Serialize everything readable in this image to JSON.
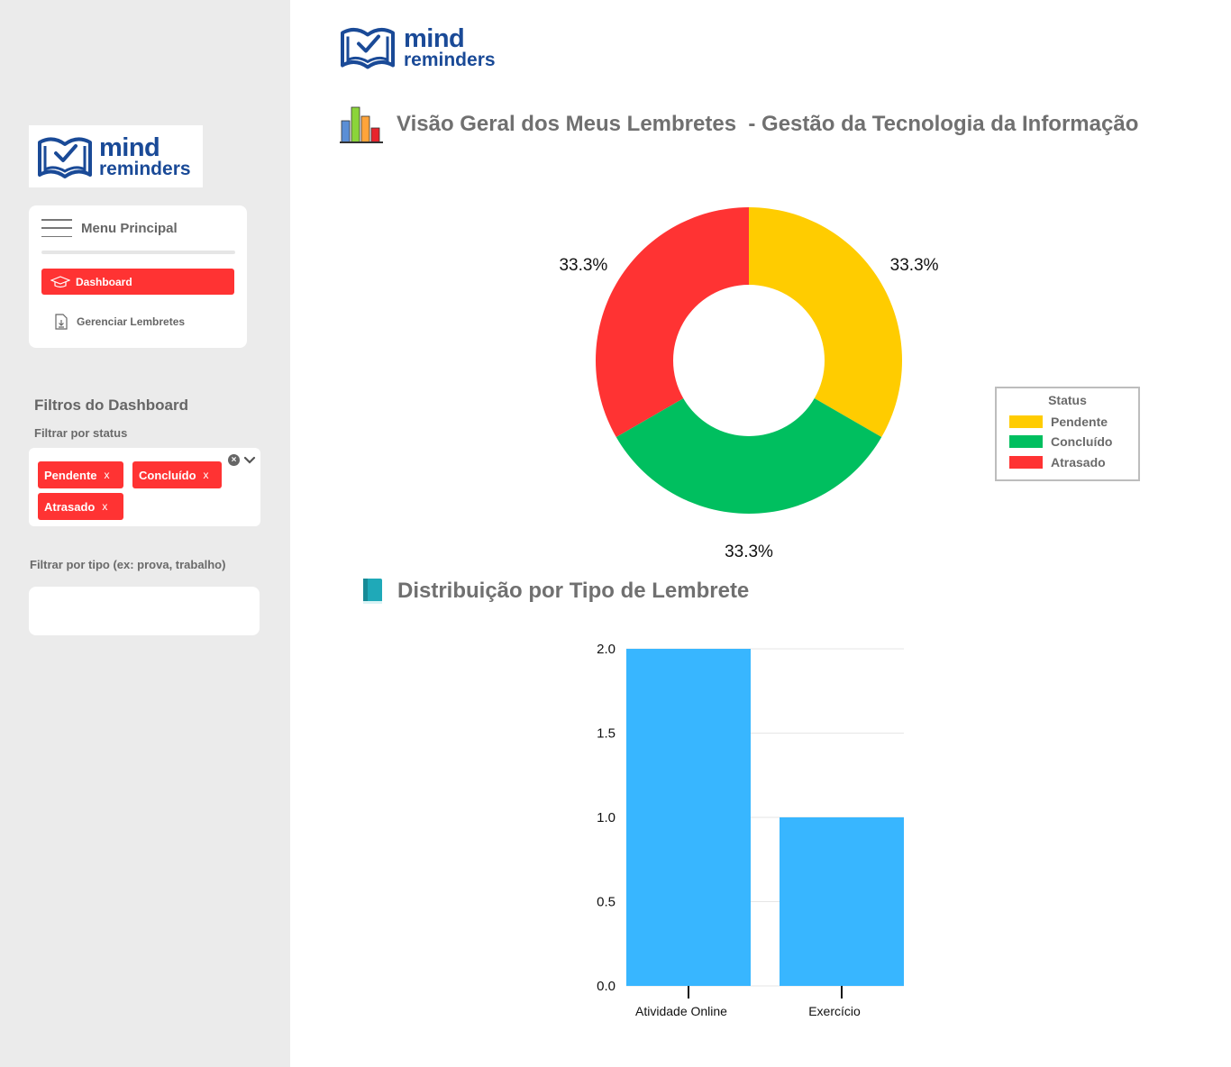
{
  "brand": {
    "line1": "mind",
    "line2": "reminders",
    "color": "#1a4a97"
  },
  "sidebar": {
    "menu_title": "Menu Principal",
    "items": [
      {
        "label": "Dashboard",
        "active": true,
        "icon": "graduation-cap-icon"
      },
      {
        "label": "Gerenciar Lembretes",
        "active": false,
        "icon": "document-download-icon"
      }
    ],
    "filters_title": "Filtros do Dashboard",
    "status_label": "Filtrar por status",
    "status_tags": [
      "Pendente",
      "Concluído",
      "Atrasado"
    ],
    "tag_remove": "x",
    "type_label": "Filtrar por tipo (ex: prova, trabalho)",
    "type_value": ""
  },
  "main": {
    "overview_title": "Visão Geral dos Meus Lembretes  - Gestão da Tecnologia da Informação",
    "distribution_title": "Distribuição por Tipo de Lembrete"
  },
  "colors": {
    "accent": "#ff3333",
    "pendente": "#ffcc00",
    "concluido": "#00bf5f",
    "atrasado": "#ff3333",
    "bar": "#38b6ff"
  },
  "chart_data": [
    {
      "type": "pie",
      "donut": true,
      "legend_title": "Status",
      "legend_position": "right",
      "labels": [
        "Pendente",
        "Concluído",
        "Atrasado"
      ],
      "values": [
        1,
        1,
        1
      ],
      "percent_labels": [
        "33.3%",
        "33.3%",
        "33.3%"
      ],
      "colors": [
        "#ffcc00",
        "#00bf5f",
        "#ff3333"
      ]
    },
    {
      "type": "bar",
      "categories": [
        "Atividade Online",
        "Exercício"
      ],
      "values": [
        2,
        1
      ],
      "ylim": [
        0,
        2
      ],
      "yticks": [
        "0.0",
        "0.5",
        "1.0",
        "1.5",
        "2.0"
      ],
      "grid": true,
      "color": "#38b6ff"
    }
  ]
}
